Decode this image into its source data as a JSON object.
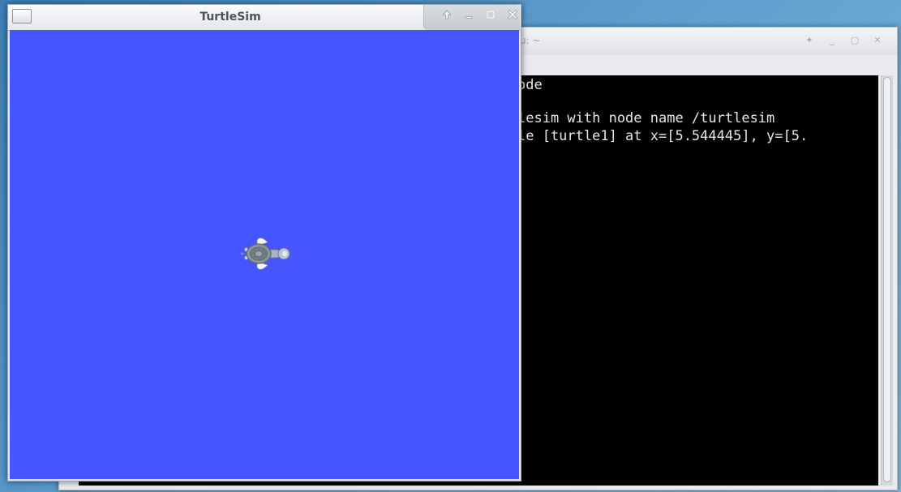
{
  "turtlesim_window": {
    "title": "TurtleSim",
    "canvas_color": "#4556ff",
    "controls": [
      {
        "name": "keep-above-button",
        "icon": "up-arrow-icon"
      },
      {
        "name": "minimize-button",
        "icon": "minimize-icon"
      },
      {
        "name": "maximize-button",
        "icon": "maximize-icon"
      },
      {
        "name": "close-button",
        "icon": "close-icon"
      }
    ],
    "turtle": {
      "name": "turtle1"
    }
  },
  "terminal_window": {
    "title_fragment": "u: ~",
    "lines": [
      "ode",
      "",
      "lesim with node name /turtlesim",
      "le [turtle1] at x=[5.544445], y=[5."
    ]
  }
}
